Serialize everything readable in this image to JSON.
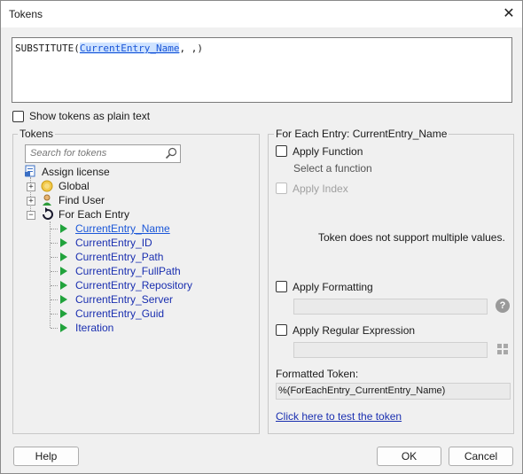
{
  "window": {
    "title": "Tokens"
  },
  "editor": {
    "prefix": "SUBSTITUTE(",
    "token": "CurrentEntry_Name",
    "suffix": ", ,)"
  },
  "options": {
    "show_plain_text": "Show tokens as plain text"
  },
  "tokens_panel": {
    "title": "Tokens",
    "search_placeholder": "Search for tokens",
    "tree": {
      "root": "Assign license",
      "nodes": [
        {
          "label": "Global",
          "icon": "coin-icon"
        },
        {
          "label": "Find User",
          "icon": "user-icon"
        },
        {
          "label": "For Each Entry",
          "icon": "loop-icon"
        }
      ],
      "children": [
        "CurrentEntry_Name",
        "CurrentEntry_ID",
        "CurrentEntry_Path",
        "CurrentEntry_FullPath",
        "CurrentEntry_Repository",
        "CurrentEntry_Server",
        "CurrentEntry_Guid",
        "Iteration"
      ],
      "selected": "CurrentEntry_Name"
    }
  },
  "right_panel": {
    "title": "For Each Entry: CurrentEntry_Name",
    "apply_function": "Apply Function",
    "select_function": "Select a function",
    "apply_index": "Apply Index",
    "no_multi": "Token does not support multiple values.",
    "apply_formatting": "Apply Formatting",
    "apply_regex": "Apply Regular Expression",
    "formatted_label": "Formatted Token:",
    "formatted_value": "%(ForEachEntry_CurrentEntry_Name)",
    "test_link": "Click here to test the token"
  },
  "buttons": {
    "help": "Help",
    "ok": "OK",
    "cancel": "Cancel"
  },
  "colors": {
    "accent": "#1a2fb0",
    "selection": "#cfe3ff",
    "play": "#21a33c"
  }
}
